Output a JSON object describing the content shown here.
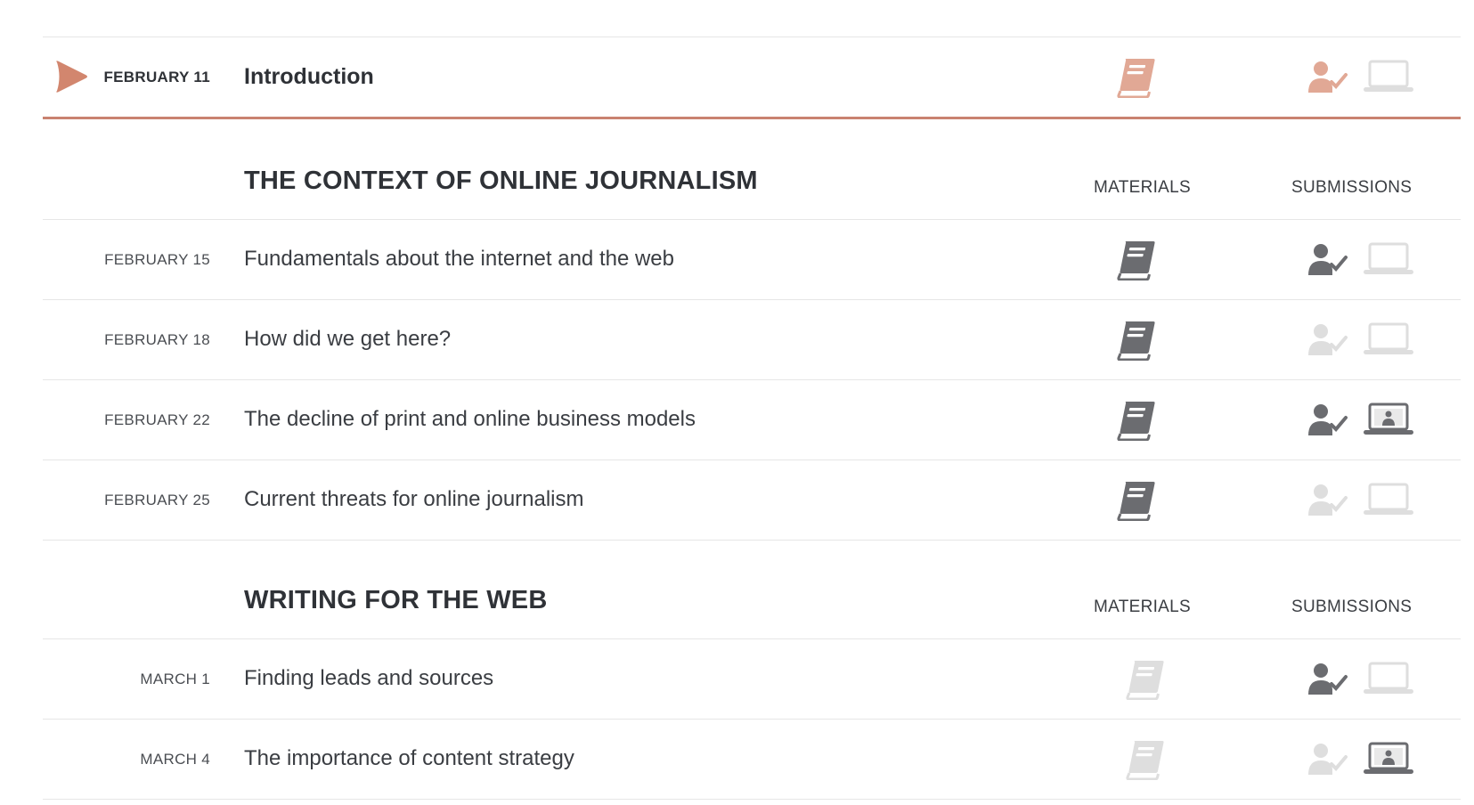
{
  "colors": {
    "accent": "#c98270",
    "accent_light": "#e1a895",
    "icon_active": "#6b6c70",
    "icon_inactive": "#dedede",
    "divider": "#e6e6e6"
  },
  "current": {
    "date": "FEBRUARY 11",
    "title": "Introduction",
    "play_icon": "play-icon",
    "material_icon": "book-icon",
    "submission_icons": [
      "person-check-icon",
      "laptop-icon"
    ]
  },
  "sections": [
    {
      "title": "THE CONTEXT OF ONLINE JOURNALISM",
      "materials_label": "MATERIALS",
      "submissions_label": "SUBMISSIONS",
      "lessons": [
        {
          "date": "FEBRUARY 15",
          "title": "Fundamentals about the internet and the web",
          "book": "active",
          "person": "active",
          "laptop": "empty"
        },
        {
          "date": "FEBRUARY 18",
          "title": "How did we get here?",
          "book": "active",
          "person": "inactive",
          "laptop": "empty"
        },
        {
          "date": "FEBRUARY 22",
          "title": "The decline of print and online business models",
          "book": "active",
          "person": "active",
          "laptop": "filled"
        },
        {
          "date": "FEBRUARY 25",
          "title": "Current threats for online journalism",
          "book": "active",
          "person": "inactive",
          "laptop": "empty"
        }
      ]
    },
    {
      "title": "WRITING FOR THE WEB",
      "materials_label": "MATERIALS",
      "submissions_label": "SUBMISSIONS",
      "lessons": [
        {
          "date": "MARCH 1",
          "title": "Finding leads and sources",
          "book": "inactive",
          "person": "active",
          "laptop": "empty"
        },
        {
          "date": "MARCH 4",
          "title": "The importance of content strategy",
          "book": "inactive",
          "person": "inactive",
          "laptop": "filled"
        }
      ]
    }
  ]
}
